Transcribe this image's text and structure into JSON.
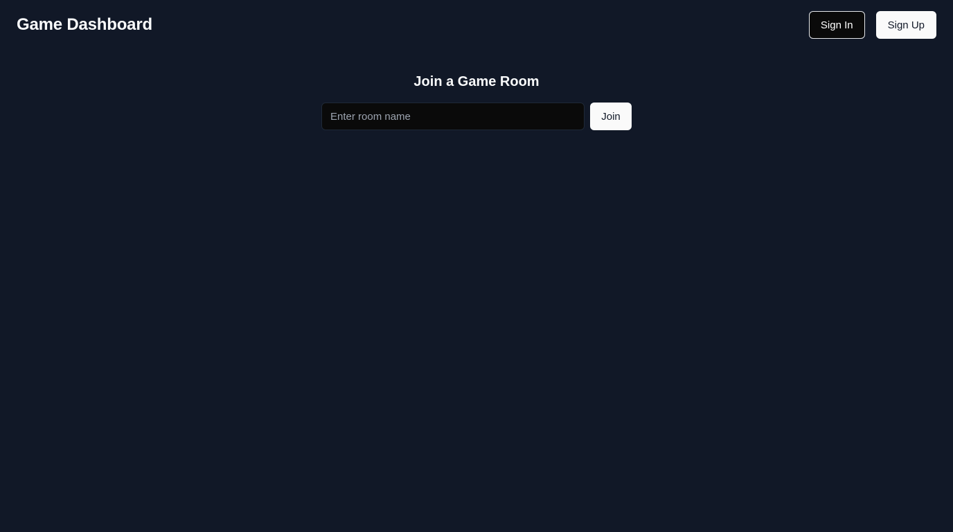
{
  "header": {
    "title": "Game Dashboard",
    "sign_in_label": "Sign In",
    "sign_up_label": "Sign Up"
  },
  "join": {
    "heading": "Join a Game Room",
    "input_value": "",
    "input_placeholder": "Enter room name",
    "button_label": "Join"
  },
  "colors": {
    "background": "#111827",
    "input_background": "#0a0a0a",
    "light_button": "#fafafa",
    "dark_button": "#0a0a0a",
    "text": "#f9fafb"
  }
}
